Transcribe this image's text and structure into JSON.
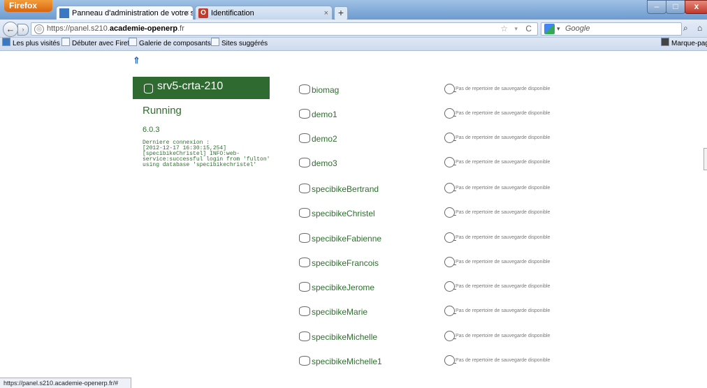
{
  "browser": {
    "app_button": "Firefox",
    "tabs": [
      {
        "label": "Panneau d'administration de votre se...",
        "close": "×"
      },
      {
        "label": "Identification",
        "close": "×",
        "favicon_letter": "O"
      }
    ],
    "newtab": "+",
    "window_controls": {
      "min": "–",
      "max": "□",
      "close": "x"
    },
    "nav": {
      "back": "←",
      "forward": "›"
    },
    "url_prefix": "https://panel.s210.",
    "url_domain": "academie-openerp",
    "url_suffix": ".fr",
    "url_star": "☆",
    "url_dropdown": "▾",
    "url_reload": "C",
    "search_dropdown": "▾",
    "search_placeholder": "Google",
    "bookmarks": [
      "Les plus visités",
      "Débuter avec Firefox",
      "Galerie de composants...",
      "Sites suggérés"
    ],
    "bookmarks_right": "Marque-pag",
    "status_url": "https://panel.s210.academie-openerp.fr/#"
  },
  "server": {
    "name": "srv5-crta-210",
    "status": "Running",
    "version": "6.0.3",
    "last_connection": "Derniere connexion :\n[2012-12-17 16:30:15,254]\n[specibikeChristel] INFO:web-\nservice:successful login from 'fulton'\nusing database 'specibikechristel'"
  },
  "backup_text": "Pas de repertoire de sauvegarde disponible",
  "databases": [
    {
      "name": "biomag"
    },
    {
      "name": "demo1"
    },
    {
      "name": "demo2"
    },
    {
      "name": "demo3"
    },
    {
      "name": "specibikeBertrand"
    },
    {
      "name": "specibikeChristel"
    },
    {
      "name": "specibikeFabienne"
    },
    {
      "name": "specibikeFrancois"
    },
    {
      "name": "specibikeJerome"
    },
    {
      "name": "specibikeMarie"
    },
    {
      "name": "specibikeMichelle"
    },
    {
      "name": "specibikeMichelle1"
    }
  ],
  "colors": {
    "accent": "#2f6b30",
    "text_green": "#2e6f2e"
  },
  "icons": {
    "up": "upload-icon",
    "db": "database-icon",
    "backup": "empty-circle-icon"
  }
}
